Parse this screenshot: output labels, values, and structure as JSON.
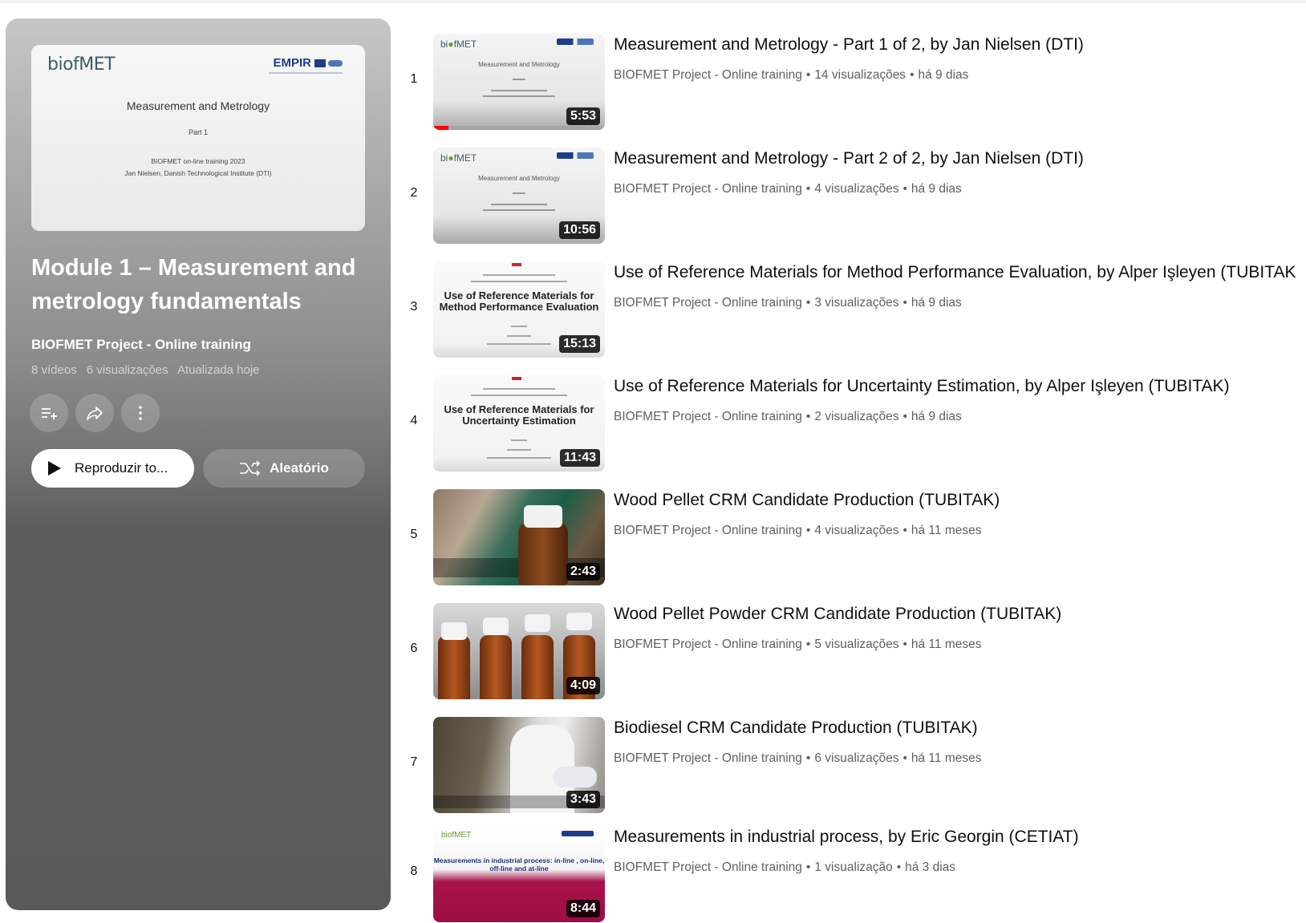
{
  "playlist": {
    "thumb_slide": {
      "logo_left": "biofMET",
      "logo_right": "EMPIR",
      "title": "Measurement and Metrology",
      "part": "Part 1",
      "line1": "BIOFMET on-line training 2023",
      "line2": "Jan Nielsen, Danish Technological Institute (DTI)"
    },
    "title": "Module 1 – Measurement and metrology fundamentals",
    "owner": "BIOFMET Project - Online training",
    "meta": {
      "videos": "8 vídeos",
      "views": "6 visualizações",
      "updated": "Atualizada hoje"
    },
    "play_all_label": "Reproduzir to...",
    "shuffle_label": "Aleatório"
  },
  "videos": [
    {
      "index": "1",
      "title": "Measurement and Metrology - Part 1 of 2, by Jan Nielsen (DTI)",
      "channel": "BIOFMET Project - Online training",
      "views": "14 visualizações",
      "age": "há 9 dias",
      "duration": "5:53",
      "watched_fraction": 0.09
    },
    {
      "index": "2",
      "title": "Measurement and Metrology - Part 2 of 2, by Jan Nielsen (DTI)",
      "channel": "BIOFMET Project - Online training",
      "views": "4 visualizações",
      "age": "há 9 dias",
      "duration": "10:56"
    },
    {
      "index": "3",
      "title": "Use of Reference Materials for Method Performance Evaluation, by Alper Işleyen (TUBITAK",
      "channel": "BIOFMET Project - Online training",
      "views": "3 visualizações",
      "age": "há 9 dias",
      "duration": "15:13",
      "thumb_text": "Use of Reference Materials for Method Performance Evaluation"
    },
    {
      "index": "4",
      "title": "Use of Reference Materials for Uncertainty Estimation, by Alper Işleyen (TUBITAK)",
      "channel": "BIOFMET Project - Online training",
      "views": "2 visualizações",
      "age": "há 9 dias",
      "duration": "11:43",
      "thumb_text": "Use of Reference Materials for Uncertainty Estimation"
    },
    {
      "index": "5",
      "title": "Wood Pellet CRM Candidate Production (TUBITAK)",
      "channel": "BIOFMET Project - Online training",
      "views": "4 visualizações",
      "age": "há 11 meses",
      "duration": "2:43"
    },
    {
      "index": "6",
      "title": "Wood Pellet Powder CRM Candidate Production (TUBITAK)",
      "channel": "BIOFMET Project - Online training",
      "views": "5 visualizações",
      "age": "há 11 meses",
      "duration": "4:09"
    },
    {
      "index": "7",
      "title": "Biodiesel CRM Candidate Production (TUBITAK)",
      "channel": "BIOFMET Project - Online training",
      "views": "6 visualizações",
      "age": "há 11 meses",
      "duration": "3:43"
    },
    {
      "index": "8",
      "title": "Measurements in industrial process, by Eric Georgin (CETIAT)",
      "channel": "BIOFMET Project - Online training",
      "views": "1 visualização",
      "age": "há 3 dias",
      "duration": "8:44",
      "thumb_text": "Measurements in industrial process: in-line , on-line, off-line and at-line"
    }
  ],
  "colors": {
    "accent_red": "#ff0000",
    "meta_gray": "#606060"
  },
  "icons": {
    "save": "add-to-queue-icon",
    "share": "share-icon",
    "more": "more-vert-icon",
    "play": "play-icon",
    "shuffle": "shuffle-icon"
  }
}
